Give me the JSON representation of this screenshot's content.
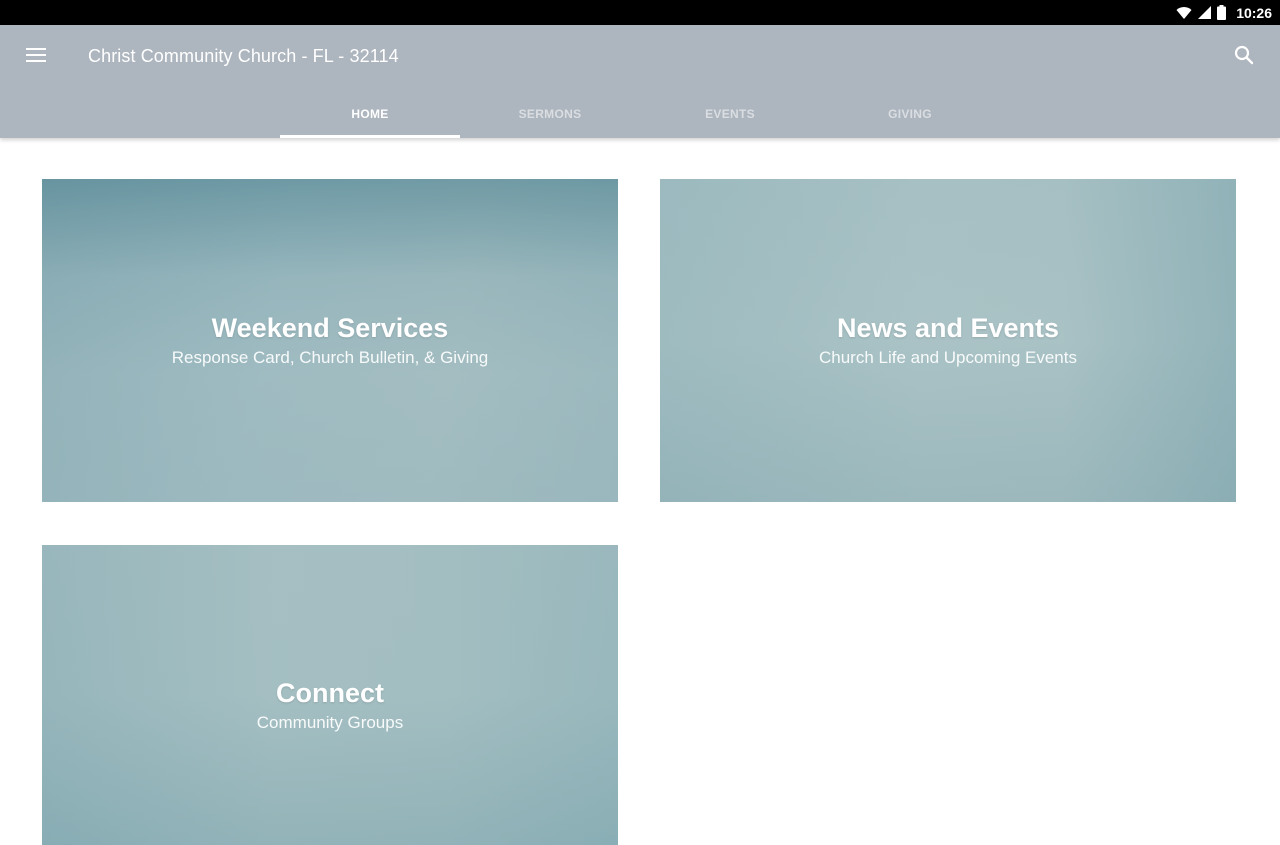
{
  "status_bar": {
    "time": "10:26",
    "icons": [
      "wifi-icon",
      "signal-icon",
      "battery-icon"
    ]
  },
  "app_bar": {
    "title": "Christ Community Church - FL - 32114",
    "menu_icon": "menu-icon",
    "search_icon": "search-icon",
    "background_color": "#adb5be"
  },
  "tabs": [
    {
      "label": "HOME",
      "active": true
    },
    {
      "label": "SERMONS",
      "active": false
    },
    {
      "label": "EVENTS",
      "active": false
    },
    {
      "label": "GIVING",
      "active": false
    }
  ],
  "cards": [
    {
      "title": "Weekend Services",
      "subtitle": "Response Card, Church Bulletin, & Giving"
    },
    {
      "title": "News and Events",
      "subtitle": "Church Life and Upcoming Events"
    },
    {
      "title": "Connect",
      "subtitle": "Community Groups"
    }
  ]
}
